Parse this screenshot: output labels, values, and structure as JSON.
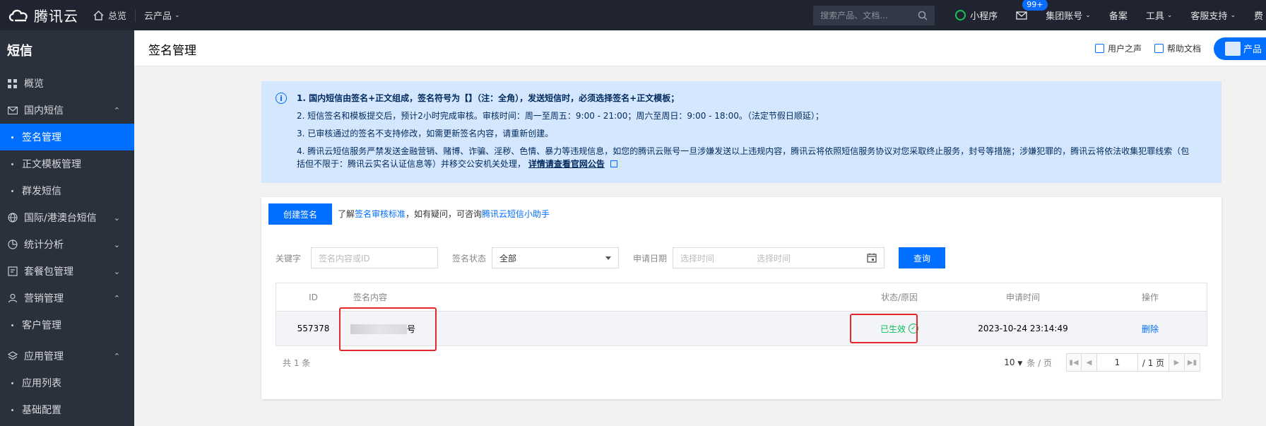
{
  "topbar": {
    "brand": "腾讯云",
    "overview": "总览",
    "products": "云产品",
    "search_placeholder": "搜索产品、文档...",
    "mini_program": "小程序",
    "badge": "99+",
    "group_account": "集团账号",
    "record": "备案",
    "tools": "工具",
    "support": "客服支持",
    "more": "费"
  },
  "sidebar": {
    "title": "短信",
    "items": {
      "overview": "概览",
      "domestic": "国内短信",
      "signature": "签名管理",
      "template": "正文模板管理",
      "bulk": "群发短信",
      "intl": "国际/港澳台短信",
      "stats": "统计分析",
      "package": "套餐包管理",
      "marketing": "营销管理",
      "customer": "客户管理",
      "apps": "应用管理",
      "app_list": "应用列表",
      "basic_config": "基础配置"
    }
  },
  "header": {
    "title": "签名管理",
    "voice": "用户之声",
    "help": "帮助文档",
    "product_tab": "产品"
  },
  "notice": {
    "line1": "1. 国内短信由签名+正文组成，签名符号为【】（注：全角），发送短信时，必须选择签名+正文模板；",
    "line2": "2. 短信签名和模板提交后，预计2小时完成审核。审核时间：周一至周五：9:00 - 21:00；周六至周日：9:00 - 18:00。（法定节假日顺延）；",
    "line3": "3. 已审核通过的签名不支持修改，如需更新签名内容，请重新创建。",
    "line4a": "4. 腾讯云短信服务严禁发送金融营销、赌博、诈骗、淫秽、色情、暴力等违规信息，如您的腾讯云账号一旦涉嫌发送以上违规内容，腾讯云将依照短信服务协议对您采取终止服务，封号等措施；涉嫌犯罪的，腾讯云将依法收集犯罪线索（包",
    "line4b": "括但不限于：腾讯云实名认证信息等）并移交公安机关处理，",
    "line4_link": "详情请查看官网公告"
  },
  "panel": {
    "create_button": "创建签名",
    "tip_prefix": "了解",
    "tip_link1": "签名审核标准",
    "tip_mid": "，如有疑问，可咨询",
    "tip_link2": "腾讯云短信小助手",
    "filters": {
      "keyword_label": "关键字",
      "keyword_placeholder": "签名内容或ID",
      "status_label": "签名状态",
      "status_value": "全部",
      "date_label": "申请日期",
      "start_placeholder": "选择时间",
      "end_placeholder": "选择时间",
      "query_button": "查询"
    },
    "table": {
      "headers": {
        "id": "ID",
        "content": "签名内容",
        "status": "状态/原因",
        "time": "申请时间",
        "op": "操作"
      },
      "rows": [
        {
          "id": "557378",
          "content_suffix": "号",
          "status": "已生效",
          "time": "2023-10-24 23:14:49",
          "op": "删除"
        }
      ]
    },
    "pager": {
      "total": "共 1 条",
      "page_size": "10",
      "per_page": "条 / 页",
      "current": "1",
      "pages": "/ 1 页"
    }
  },
  "colors": {
    "primary": "#006eff",
    "success": "#0abf5b",
    "highlight": "#e6262c"
  }
}
